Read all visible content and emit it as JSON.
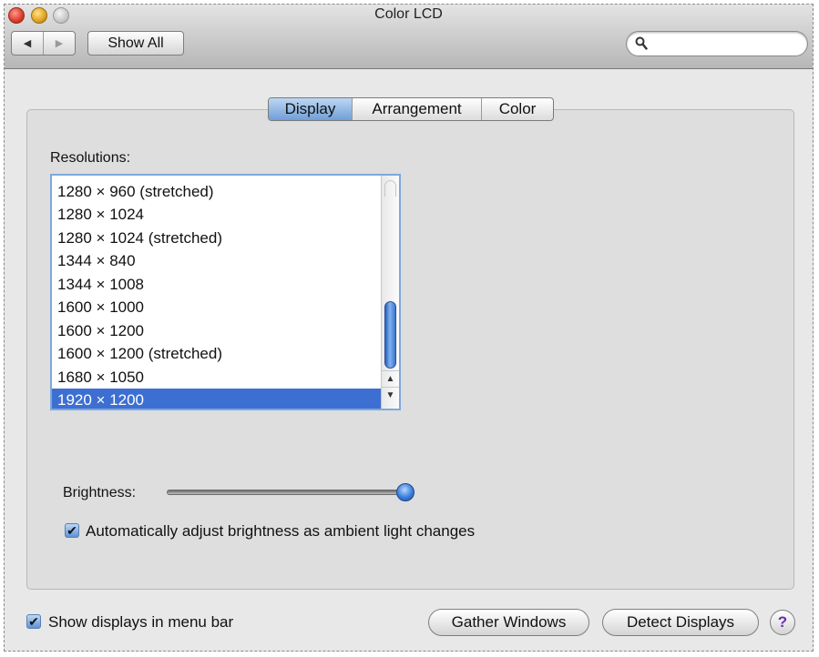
{
  "window": {
    "title": "Color LCD"
  },
  "toolbar": {
    "back_icon": "◀",
    "forward_icon": "▶",
    "show_all_label": "Show All",
    "search_placeholder": "",
    "search_value": ""
  },
  "tabs": [
    {
      "label": "Display",
      "active": true
    },
    {
      "label": "Arrangement",
      "active": false
    },
    {
      "label": "Color",
      "active": false
    }
  ],
  "resolutions": {
    "label": "Resolutions:",
    "items": [
      "1280 × 960 (stretched)",
      "1280 × 1024",
      "1280 × 1024 (stretched)",
      "1344 × 840",
      "1344 × 1008",
      "1600 × 1000",
      "1600 × 1200",
      "1600 × 1200 (stretched)",
      "1680 × 1050",
      "1920 × 1200"
    ],
    "selected": "1920 × 1200"
  },
  "brightness": {
    "label": "Brightness:",
    "value_fraction": 0.98
  },
  "auto_brightness": {
    "label": "Automatically adjust brightness as ambient light changes",
    "checked": true
  },
  "footer": {
    "show_in_menu_bar_label": "Show displays in menu bar",
    "show_in_menu_bar_checked": true,
    "gather_label": "Gather Windows",
    "detect_label": "Detect Displays",
    "help_label": "?"
  },
  "colors": {
    "selection": "#3d6fd2",
    "tab_active": "#6f9fd8",
    "help_glyph": "#6a2fb0"
  }
}
